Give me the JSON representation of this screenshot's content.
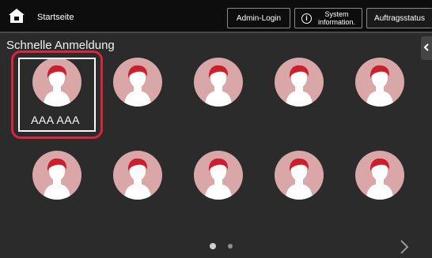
{
  "header": {
    "home_label": "Startseite",
    "admin_login_label": "Admin-Login",
    "sysinfo_line1": "System",
    "sysinfo_line2": "information.",
    "job_status_label": "Auftragsstatus"
  },
  "section_title": "Schnelle Anmeldung",
  "users": [
    {
      "name": "AAA AAA",
      "selected": true
    },
    {
      "name": "",
      "selected": false
    },
    {
      "name": "",
      "selected": false
    },
    {
      "name": "",
      "selected": false
    },
    {
      "name": "",
      "selected": false
    },
    {
      "name": "",
      "selected": false
    },
    {
      "name": "",
      "selected": false
    },
    {
      "name": "",
      "selected": false
    },
    {
      "name": "",
      "selected": false
    },
    {
      "name": "",
      "selected": false
    }
  ],
  "pagination": {
    "current_page": 1,
    "total_pages": 2
  },
  "colors": {
    "accent_red": "#d7263d",
    "avatar_bg": "#d9a7a7",
    "hair_red": "#cc1f2d"
  }
}
